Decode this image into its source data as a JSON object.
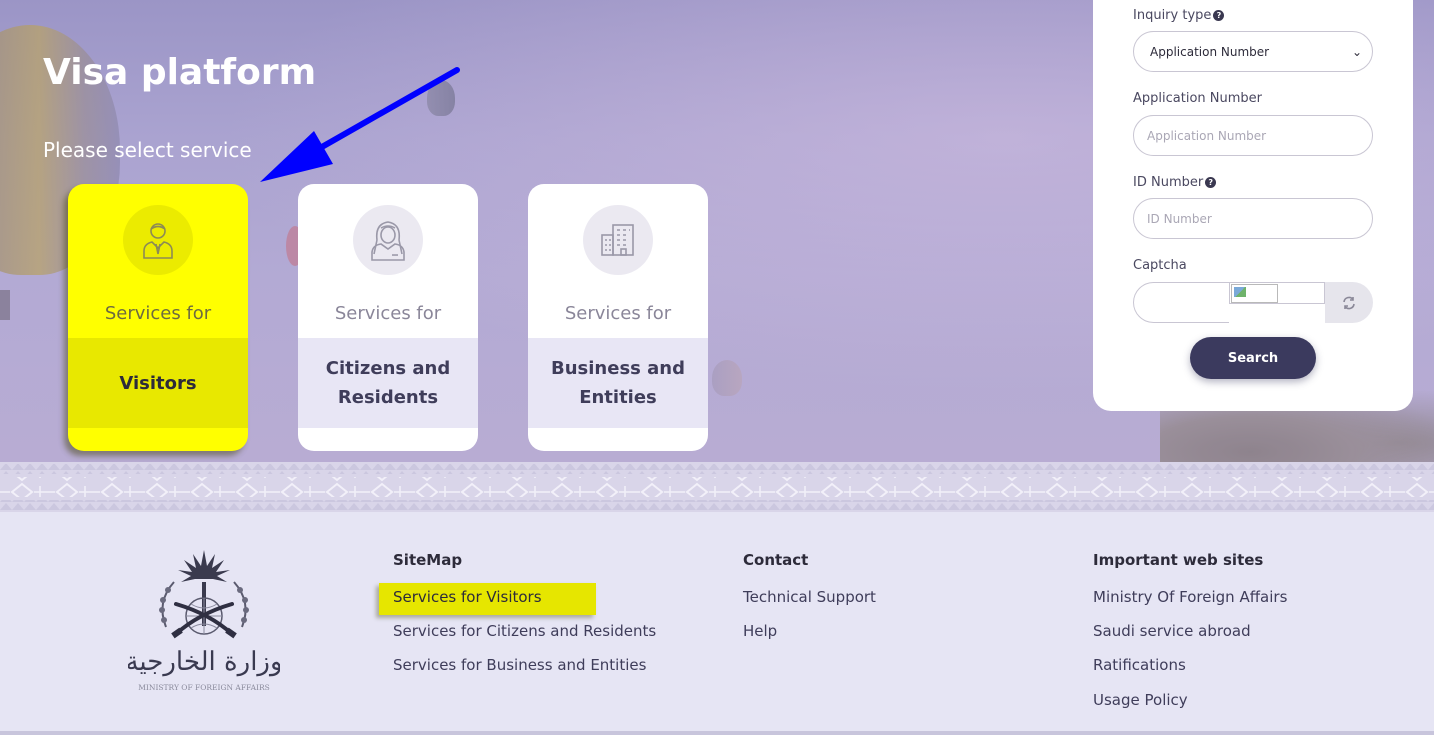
{
  "hero": {
    "title": "Visa platform",
    "subtitle": "Please select service"
  },
  "services": [
    {
      "prefix": "Services for",
      "name": "Visitors",
      "icon": "visitor-icon",
      "highlighted": true
    },
    {
      "prefix": "Services for",
      "name_line1": "Citizens and",
      "name_line2": "Residents",
      "icon": "citizen-icon"
    },
    {
      "prefix": "Services for",
      "name_line1": "Business and",
      "name_line2": "Entities",
      "icon": "building-icon"
    }
  ],
  "inquiry": {
    "type_label": "Inquiry type",
    "type_value": "Application Number",
    "app_label": "Application Number",
    "app_placeholder": "Application Number",
    "id_label": "ID Number",
    "id_placeholder": "ID Number",
    "captcha_label": "Captcha",
    "search_label": "Search"
  },
  "footer": {
    "sitemap": {
      "title": "SiteMap",
      "links": [
        "Services for Visitors",
        "Services for Citizens and Residents",
        "Services for Business and Entities"
      ]
    },
    "contact": {
      "title": "Contact",
      "links": [
        "Technical Support",
        "Help"
      ]
    },
    "important": {
      "title": "Important web sites",
      "links": [
        "Ministry Of Foreign Affairs",
        "Saudi service abroad",
        "Ratifications",
        "Usage Policy"
      ]
    },
    "logo": {
      "arabic": "وزارة الخارجية",
      "english": "MINISTRY OF FOREIGN AFFAIRS"
    }
  },
  "colors": {
    "highlight": "#ffff00",
    "arrow": "#0000ff",
    "primary_button": "#3b3a5e"
  }
}
